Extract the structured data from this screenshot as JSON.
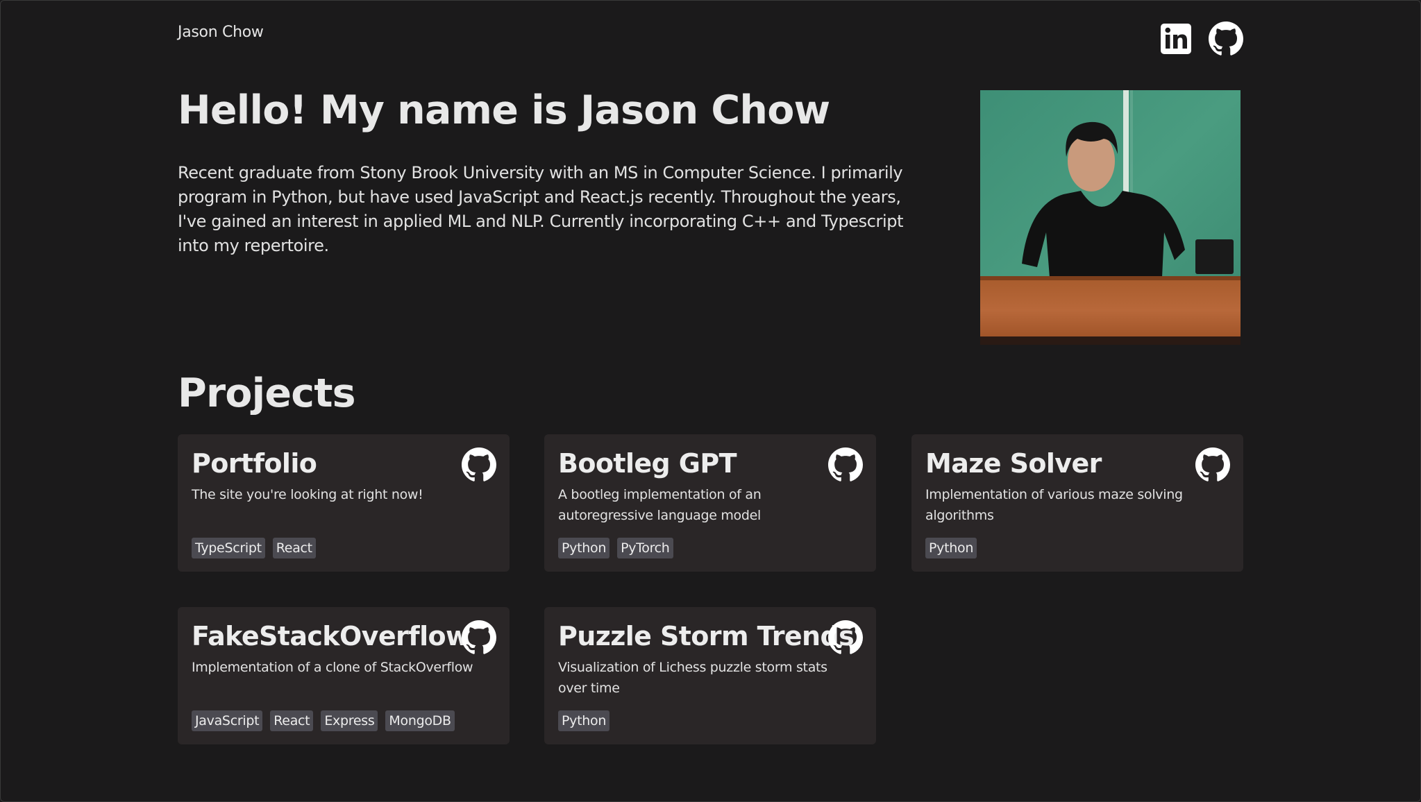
{
  "header": {
    "site_name": "Jason Chow",
    "social": [
      {
        "name": "linkedin-icon",
        "label": "LinkedIn"
      },
      {
        "name": "github-icon",
        "label": "GitHub"
      }
    ]
  },
  "hero": {
    "title": "Hello! My name is Jason Chow",
    "bio": "Recent graduate from Stony Brook University with an MS in Computer Science. I primarily program in Python, but have used JavaScript and React.js recently. Throughout the years, I've gained an interest in applied ML and NLP. Currently incorporating C++ and Typescript into my repertoire.",
    "portrait_alt": "Jason Chow at a podium"
  },
  "projects": {
    "heading": "Projects",
    "items": [
      {
        "title": "Portfolio",
        "description": "The site you're looking at right now!",
        "tags": [
          "TypeScript",
          "React"
        ]
      },
      {
        "title": "Bootleg GPT",
        "description": "A bootleg implementation of an autoregressive language model",
        "tags": [
          "Python",
          "PyTorch"
        ]
      },
      {
        "title": "Maze Solver",
        "description": "Implementation of various maze solving algorithms",
        "tags": [
          "Python"
        ]
      },
      {
        "title": "FakeStackOverflow",
        "description": "Implementation of a clone of StackOverflow",
        "tags": [
          "JavaScript",
          "React",
          "Express",
          "MongoDB"
        ]
      },
      {
        "title": "Puzzle Storm Trends",
        "description": "Visualization of Lichess puzzle storm stats over time",
        "tags": [
          "Python"
        ]
      }
    ]
  },
  "colors": {
    "background": "#1b1a1b",
    "card": "#2a2627",
    "tag": "#4b4a51",
    "text": "#e6e6e6"
  }
}
